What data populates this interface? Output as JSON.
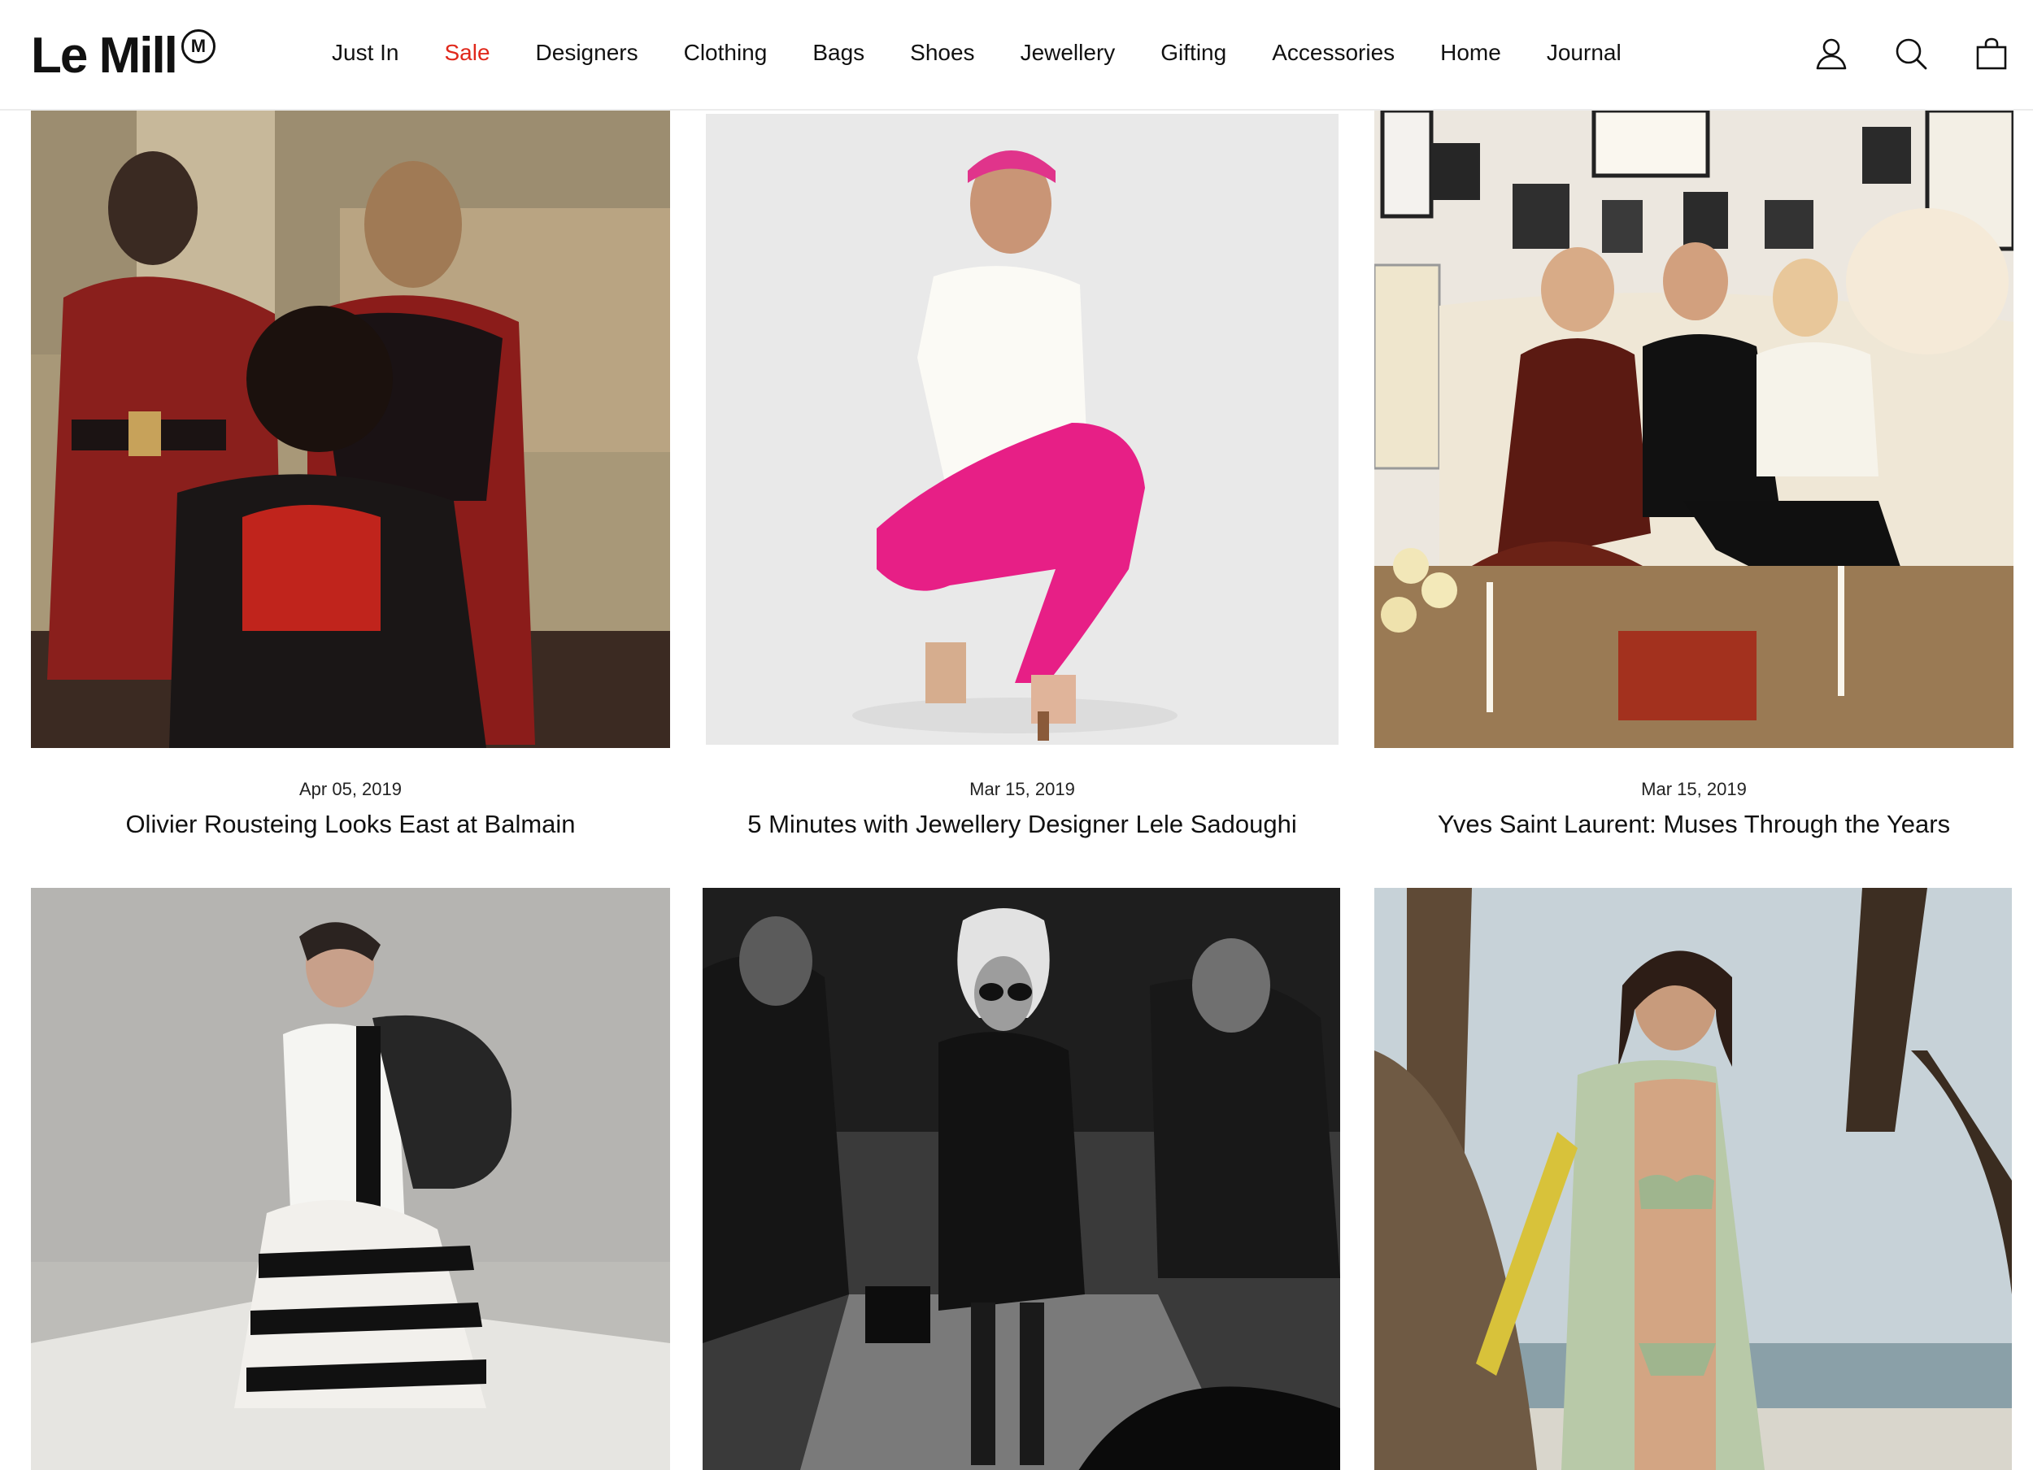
{
  "brand": {
    "name": "Le Mill",
    "mark": "M"
  },
  "nav": {
    "items": [
      {
        "label": "Just In"
      },
      {
        "label": "Sale"
      },
      {
        "label": "Designers"
      },
      {
        "label": "Clothing"
      },
      {
        "label": "Bags"
      },
      {
        "label": "Shoes"
      },
      {
        "label": "Jewellery"
      },
      {
        "label": "Gifting"
      },
      {
        "label": "Accessories"
      },
      {
        "label": "Home"
      },
      {
        "label": "Journal"
      }
    ]
  },
  "header_icons": [
    "account-icon",
    "search-icon",
    "shopping-bag-icon"
  ],
  "colors": {
    "sale": "#e0281b",
    "text": "#111111",
    "divider": "#ececec"
  },
  "articles": [
    {
      "date": "Apr 05, 2019",
      "title": "Olivier Rousteing Looks East at Balmain"
    },
    {
      "date": "Mar 15, 2019",
      "title": "5 Minutes with Jewellery Designer Lele Sadoughi"
    },
    {
      "date": "Mar 15, 2019",
      "title": "Yves Saint Laurent: Muses Through the Years"
    },
    {
      "date": "",
      "title": ""
    },
    {
      "date": "",
      "title": ""
    },
    {
      "date": "",
      "title": ""
    }
  ]
}
